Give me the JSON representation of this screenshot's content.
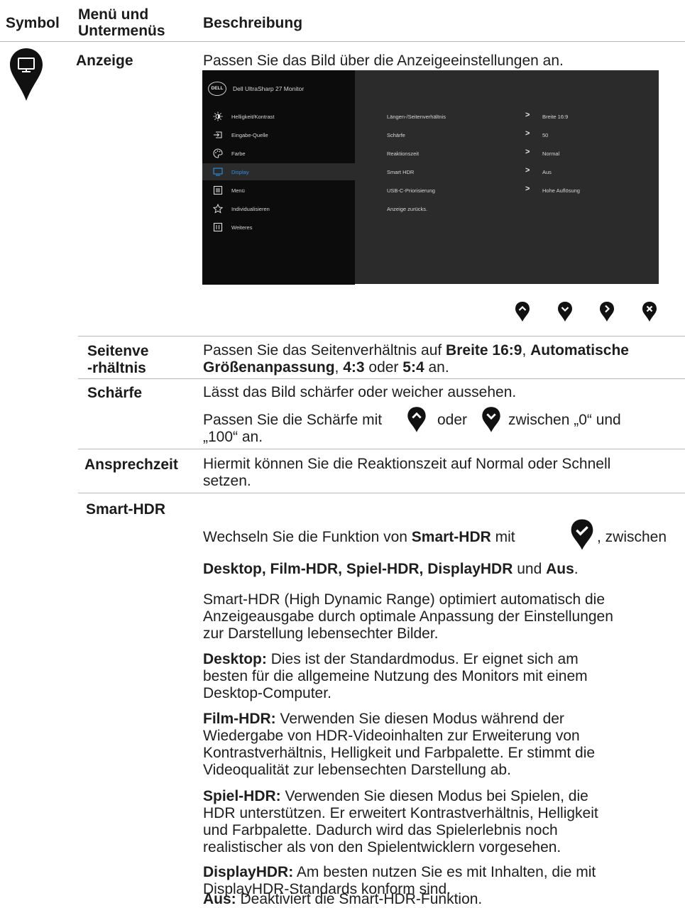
{
  "header": {
    "symbol": "Symbol",
    "menu_line1": "Menü und",
    "menu_line2": "Untermenüs",
    "description": "Beschreibung"
  },
  "main_menu": {
    "label": "Anzeige",
    "intro": "Passen Sie das Bild über die Anzeigeeinstellungen an.",
    "icon": "monitor-icon"
  },
  "osd": {
    "brand": "DELL",
    "title": "Dell UltraSharp 27 Monitor",
    "menu_items": [
      {
        "label": "Helligkeit/Kontrast",
        "icon": "brightness-icon"
      },
      {
        "label": "Eingabe-Quelle",
        "icon": "input-icon"
      },
      {
        "label": "Farbe",
        "icon": "palette-icon"
      },
      {
        "label": "Display",
        "icon": "display-icon",
        "selected": true
      },
      {
        "label": "Menü",
        "icon": "menu-icon"
      },
      {
        "label": "Individualisieren",
        "icon": "star-icon"
      },
      {
        "label": "Weiteres",
        "icon": "info-icon"
      }
    ],
    "settings": [
      {
        "label": "Längen-/Seitenverhältnis",
        "value": "Breite 16:9"
      },
      {
        "label": "Schärfe",
        "value": "50"
      },
      {
        "label": "Reaktionszeit",
        "value": "Normal"
      },
      {
        "label": "Smart HDR",
        "value": "Aus"
      },
      {
        "label": "USB-C-Priorisierung",
        "value": "Hohe Auflösung"
      },
      {
        "label": "Anzeige zurücks.",
        "value": ""
      }
    ],
    "accent_color": "#2f8fe0",
    "nav_buttons": [
      "up-icon",
      "down-icon",
      "right-icon",
      "close-icon"
    ]
  },
  "rows": {
    "aspect": {
      "label_line1": "Seitenve",
      "label_line2": "-rhältnis",
      "t1": "Passen Sie das Seitenverhältnis auf ",
      "b1": "Breite 16:9",
      "t2": ", ",
      "b2": "Automatische",
      "b3": "Größenanpassung",
      "t3": ", ",
      "b4": "4:3",
      "t4": " oder ",
      "b5": "5:4",
      "t5": " an."
    },
    "sharpness": {
      "label": "Schärfe",
      "p1": "Lässt das Bild schärfer oder weicher aussehen.",
      "p2a": "Passen Sie die Schärfe mit",
      "p2b": "oder",
      "p2c": "zwischen „0“ und",
      "p2d": "„100“ an."
    },
    "response": {
      "label": "Ansprechzeit",
      "line1": "Hiermit können Sie die Reaktionszeit auf Normal oder Schnell",
      "line2": "setzen."
    },
    "smarthdr": {
      "label": "Smart-HDR",
      "l1a": "Wechseln Sie die Funktion von ",
      "l1b": "Smart-HDR",
      "l1c": " mit",
      "l1d": ", zwischen",
      "l2a": "Desktop, Film-HDR, Spiel-HDR, DisplayHDR",
      "l2b": " und ",
      "l2c": "Aus",
      "l2d": ".",
      "p3": [
        "Smart-HDR (High Dynamic Range) optimiert automatisch die",
        "Anzeigeausgabe durch optimale Anpassung der Einstellungen",
        "zur Darstellung lebensechter Bilder."
      ],
      "desktop_b": "Desktop:",
      "desktop": [
        " Dies ist der Standardmodus. Er eignet sich am",
        "besten für die allgemeine Nutzung des Monitors mit einem",
        "Desktop-Computer."
      ],
      "film_b": "Film-HDR:",
      "film": [
        " Verwenden Sie diesen Modus während der",
        "Wiedergabe von HDR-Videoinhalten zur Erweiterung von",
        "Kontrastverhältnis, Helligkeit und Farbpalette. Er stimmt die",
        "Videoqualität zur lebensechten Darstellung ab."
      ],
      "spiel_b": "Spiel-HDR:",
      "spiel": [
        " Verwenden Sie diesen Modus bei Spielen, die",
        "HDR unterstützen. Er erweitert Kontrastverhältnis, Helligkeit",
        "und Farbpalette. Dadurch wird das Spielerlebnis noch",
        "realistischer als von den Spielentwicklern vorgesehen."
      ],
      "dhdr_b": "DisplayHDR:",
      "dhdr": [
        " Am besten nutzen Sie es mit Inhalten, die mit",
        "DisplayHDR-Standards konform sind."
      ],
      "aus_b": "Aus:",
      "aus": " Deaktiviert die Smart-HDR-Funktion."
    }
  }
}
